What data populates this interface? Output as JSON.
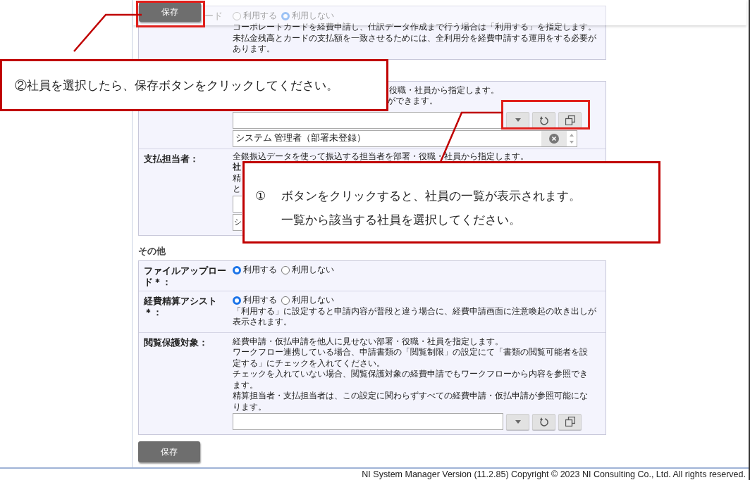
{
  "toolbar": {
    "save_button": "保存"
  },
  "panels": [
    {
      "rows": [
        {
          "kind": "radio",
          "label": "ード",
          "radios": [
            {
              "label": "利用する",
              "selected": false
            },
            {
              "label": "利用しない",
              "selected": true
            }
          ],
          "description": [
            "コーポレートカードを経費申請し、仕訳データ作成まで行う場合は「利用する」を指定します。",
            "未払金残高とカードの支払額を一致させるためには、全利用分を経費申請する運用をする必要があります。"
          ]
        }
      ]
    },
    {
      "rows": [
        {
          "kind": "picker",
          "fragments": [
            "役職・社員から指定します。",
            "ができます。"
          ],
          "items": [
            "システム 管理者（部署未登録）"
          ]
        },
        {
          "kind": "covered",
          "label": "支払担当者：",
          "description": [
            "全銀振込データを使って振込する担当者を部署・役職・社員から指定します。"
          ],
          "fragments": [
            {
              "text": "社",
              "bold": true
            },
            {
              "text": "精",
              "bold": false
            },
            {
              "text": "と",
              "bold": false
            }
          ],
          "items": [
            "シ"
          ]
        }
      ]
    },
    {
      "heading": "その他",
      "rows": [
        {
          "kind": "radio",
          "label": "ファイルアップロード＊：",
          "radios": [
            {
              "label": "利用する",
              "selected": true
            },
            {
              "label": "利用しない",
              "selected": false
            }
          ]
        },
        {
          "kind": "radio",
          "label": "経費精算アシスト＊：",
          "radios": [
            {
              "label": "利用する",
              "selected": true
            },
            {
              "label": "利用しない",
              "selected": false
            }
          ],
          "description": [
            "「利用する」に設定すると申請内容が普段と違う場合に、経費申請画面に注意喚起の吹き出しが表示されます。"
          ]
        },
        {
          "kind": "picker",
          "label": "閲覧保護対象：",
          "description": [
            "経費申請・仮払申請を他人に見せない部署・役職・社員を指定します。",
            "ワークフロー連携している場合、申請書類の「閲覧制限」の設定にて「書類の閲覧可能者を設定する」にチェックを入れてください。",
            "チェックを入れていない場合、閲覧保護対象の経費申請でもワークフローから内容を参照できます。",
            "精算担当者・支払担当者は、この設定に関わらずすべての経費申請・仮払申請が参照可能になります。"
          ]
        }
      ]
    }
  ],
  "save_button": "保存",
  "footer": "NI System Manager Version (11.2.85) Copyright © 2023 NI Consulting Co., Ltd. All rights reserved.",
  "callouts": [
    {
      "lines": [
        "②社員を選択したら、保存ボタンをクリックしてください。"
      ]
    },
    {
      "number": "①",
      "lines": [
        "ボタンをクリックすると、社員の一覧が表示されます。",
        "一覧から該当する社員を選択してください。"
      ]
    }
  ]
}
